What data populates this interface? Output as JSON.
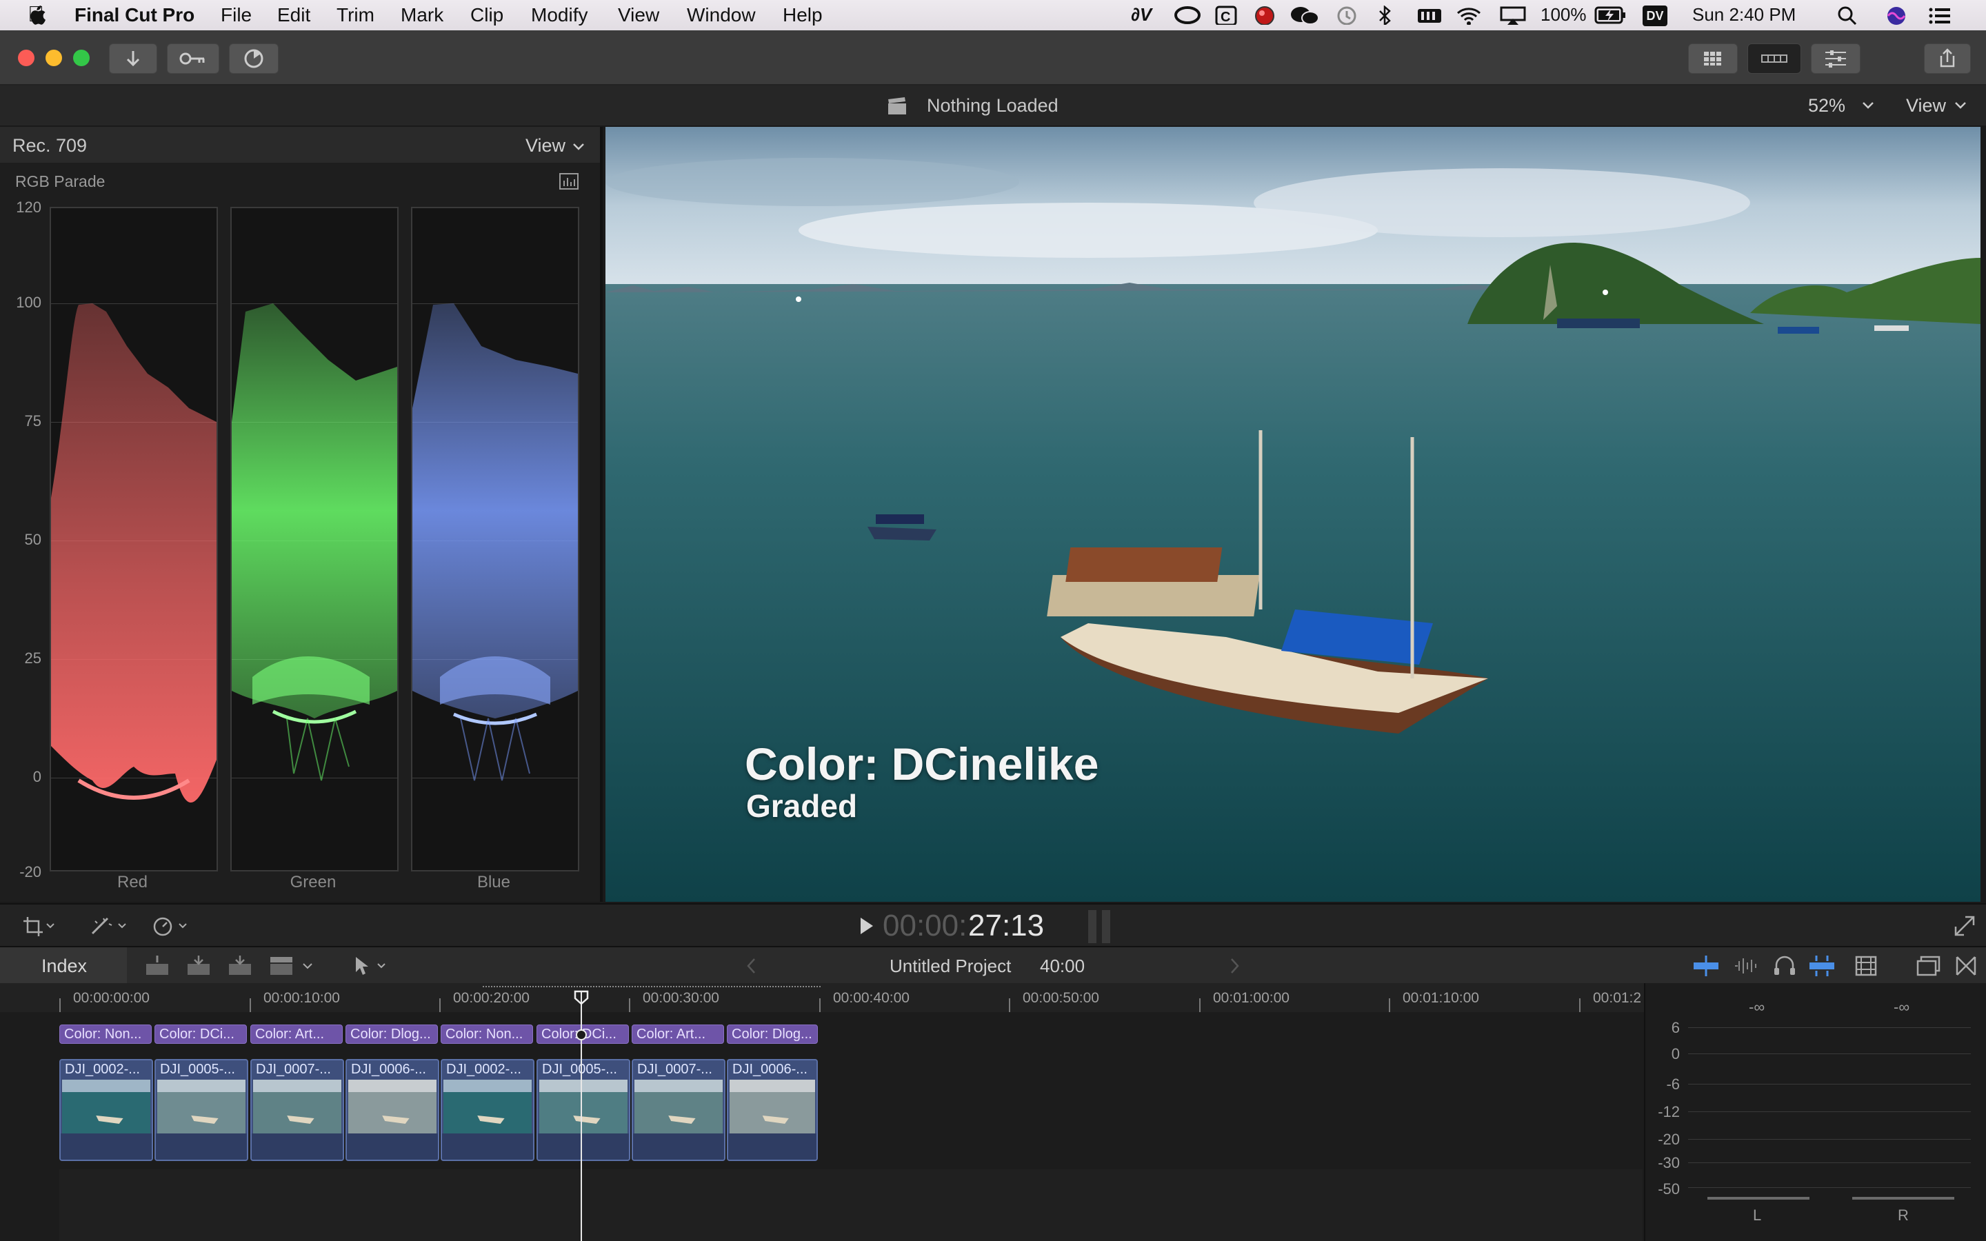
{
  "menubar": {
    "app_name": "Final Cut Pro",
    "items": [
      "File",
      "Edit",
      "Trim",
      "Mark",
      "Clip",
      "Modify",
      "View",
      "Window",
      "Help"
    ],
    "battery": "100%",
    "dv_badge": "DV",
    "clock": "Sun 2:40 PM"
  },
  "viewer_header": {
    "status": "Nothing Loaded",
    "zoom": "52%",
    "view_label": "View"
  },
  "scope": {
    "color_space": "Rec. 709",
    "view_label": "View",
    "type_label": "RGB Parade",
    "y_ticks": [
      "120",
      "100",
      "75",
      "50",
      "25",
      "0",
      "-20"
    ],
    "channels": [
      "Red",
      "Green",
      "Blue"
    ]
  },
  "viewer": {
    "title_line1": "Color: DCinelike",
    "title_line2": "Graded"
  },
  "transport": {
    "timecode_dim": "00:00:",
    "timecode_bright": "27:13"
  },
  "timeline_bar": {
    "index_label": "Index",
    "project_name": "Untitled Project",
    "project_duration": "40:00"
  },
  "ruler": {
    "labels": [
      "00:00:00:00",
      "00:00:10:00",
      "00:00:20:00",
      "00:00:30:00",
      "00:00:40:00",
      "00:00:50:00",
      "00:01:00:00",
      "00:01:10:00",
      "00:01:2"
    ]
  },
  "title_clips": [
    "Color: Non...",
    "Color: DCi...",
    "Color: Art...",
    "Color: Dlog...",
    "Color: Non...",
    "Color: DCi...",
    "Color: Art...",
    "Color: Dlog..."
  ],
  "video_clips": [
    "DJI_0002-...",
    "DJI_0005-...",
    "DJI_0007-...",
    "DJI_0006-...",
    "DJI_0002-...",
    "DJI_0005-...",
    "DJI_0007-...",
    "DJI_0006-..."
  ],
  "meters": {
    "peak_left": "-∞",
    "peak_right": "-∞",
    "scale": [
      "6",
      "0",
      "-6",
      "-12",
      "-20",
      "-30",
      "-50"
    ],
    "channels": [
      "L",
      "R"
    ]
  },
  "colors": {
    "accent_blue": "#4a8fe8",
    "title_clip": "#6e54a8",
    "video_clip": "#3e4f7c"
  }
}
